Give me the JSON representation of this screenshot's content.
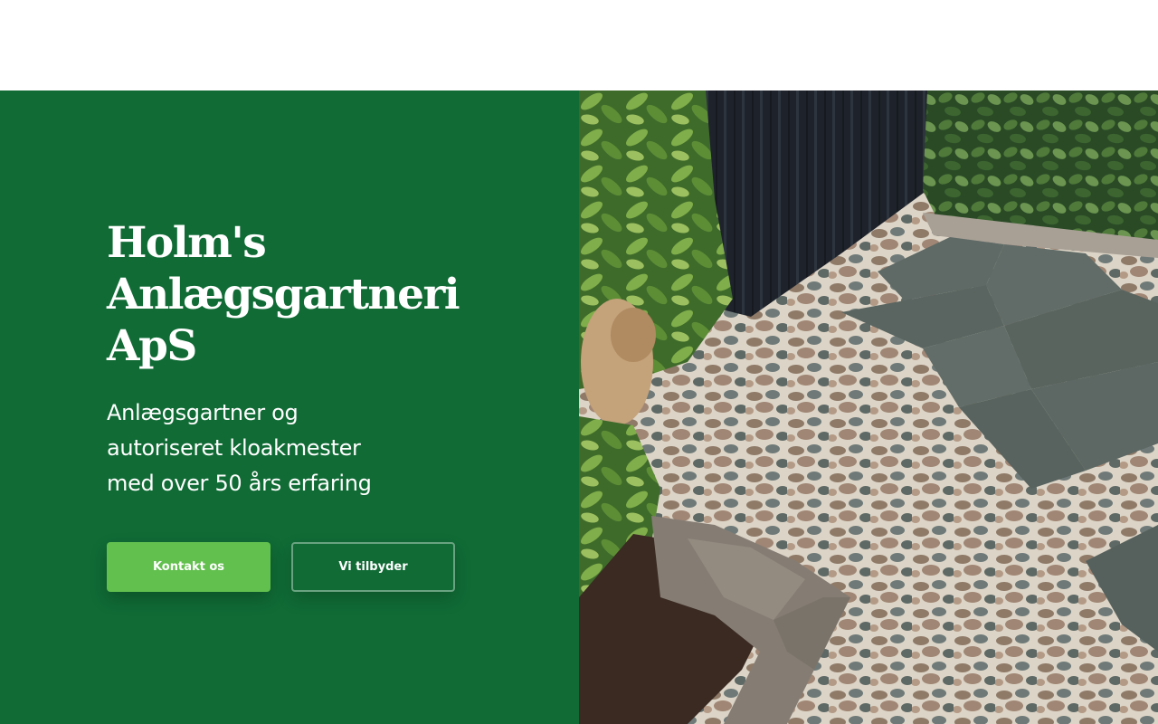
{
  "hero": {
    "title_line1": "Holm's",
    "title_line2": "Anlægsgartneri",
    "title_line3": "ApS",
    "subtitle_line1": "Anlægsgartner og",
    "subtitle_line2": "autoriseret kloakmester",
    "subtitle_line3": "med over 50 års erfaring",
    "primary_button": "Kontakt os",
    "secondary_button": "Vi tilbyder"
  },
  "colors": {
    "hero_background": "#106b35",
    "primary_button": "#62c04e",
    "text": "#ffffff"
  }
}
